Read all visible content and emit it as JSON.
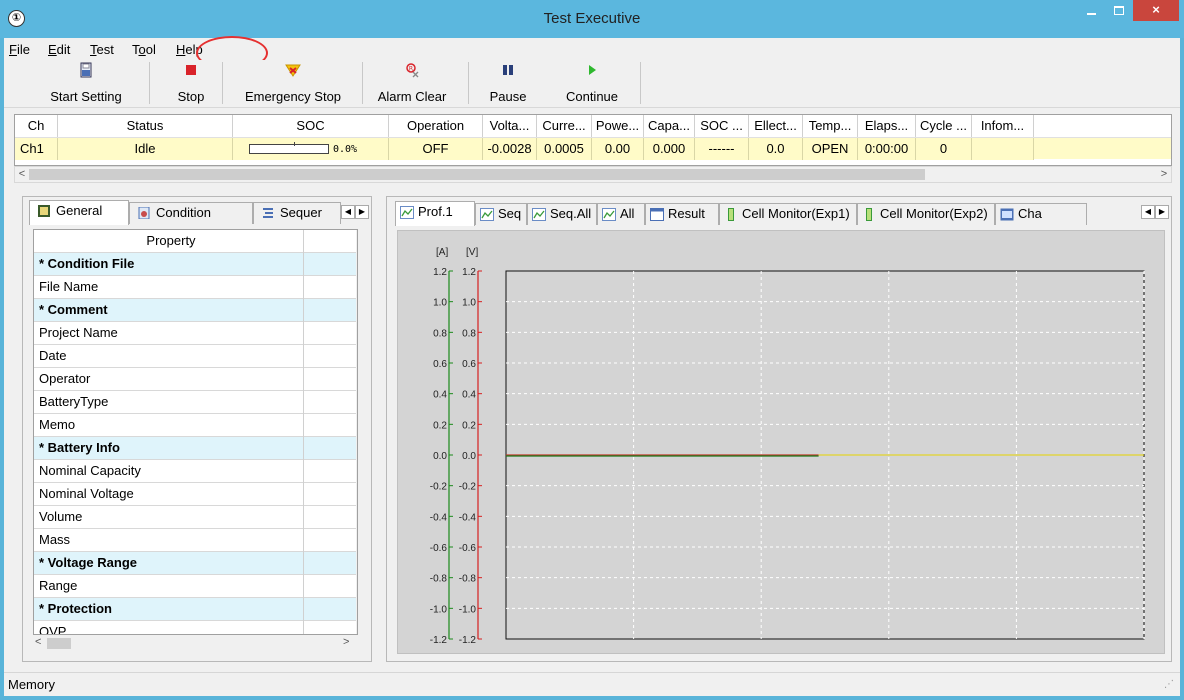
{
  "window": {
    "title": "Test Executive",
    "icon_glyph": "①",
    "minimize_icon": "minimize-icon",
    "maximize_icon": "maximize-icon",
    "close_glyph": "×"
  },
  "menu": {
    "items": [
      {
        "label": "File",
        "mnemonic": "F"
      },
      {
        "label": "Edit",
        "mnemonic": "E"
      },
      {
        "label": "Test",
        "mnemonic": "T"
      },
      {
        "label": "Tool",
        "mnemonic": "o"
      },
      {
        "label": "Help",
        "mnemonic": "H"
      }
    ]
  },
  "toolbar": {
    "start_setting": "Start Setting",
    "stop": "Stop",
    "emergency_stop": "Emergency Stop",
    "alarm_clear": "Alarm Clear",
    "pause": "Pause",
    "continue": "Continue"
  },
  "channel_table": {
    "headers": [
      "Ch",
      "Status",
      "SOC",
      "Operation",
      "Volta...",
      "Curre...",
      "Powe...",
      "Capa...",
      "SOC ...",
      "Ellect...",
      "Temp...",
      "Elaps...",
      "Cycle ...",
      "Infom..."
    ],
    "row": {
      "ch": "Ch1",
      "status": "Idle",
      "soc_text": "0.0%",
      "soc_fraction": 0.0,
      "operation": "OFF",
      "voltage": "-0.0028",
      "current": "0.0005",
      "power": "0.00",
      "capacity": "0.000",
      "soc2": "------",
      "ellect": "0.0",
      "temp": "OPEN",
      "elapsed": "0:00:00",
      "cycle": "0",
      "info": ""
    }
  },
  "left_panel": {
    "tabs": [
      "General",
      "Condition",
      "Sequer"
    ],
    "property_header": "Property",
    "rows": [
      {
        "label": "* Condition File",
        "section": true
      },
      {
        "label": "File Name",
        "section": false
      },
      {
        "label": "* Comment",
        "section": true
      },
      {
        "label": "Project Name",
        "section": false
      },
      {
        "label": "Date",
        "section": false
      },
      {
        "label": "Operator",
        "section": false
      },
      {
        "label": "BatteryType",
        "section": false
      },
      {
        "label": "Memo",
        "section": false
      },
      {
        "label": "* Battery Info",
        "section": true
      },
      {
        "label": "Nominal Capacity",
        "section": false
      },
      {
        "label": "Nominal Voltage",
        "section": false
      },
      {
        "label": "Volume",
        "section": false
      },
      {
        "label": "Mass",
        "section": false
      },
      {
        "label": "* Voltage Range",
        "section": true
      },
      {
        "label": "Range",
        "section": false
      },
      {
        "label": "* Protection",
        "section": true
      },
      {
        "label": "OVP",
        "section": false
      }
    ]
  },
  "right_panel": {
    "tabs": [
      "Prof.1",
      "Seq",
      "Seq.All",
      "All",
      "Result",
      "Cell Monitor(Exp1)",
      "Cell Monitor(Exp2)",
      "Cha"
    ]
  },
  "chart_data": {
    "type": "line",
    "title": "",
    "left_axis_label": "[A]",
    "right_axis_label": "[V]",
    "ylim": [
      -1.2,
      1.2
    ],
    "yticks": [
      "1.2",
      "1.0",
      "0.8",
      "0.6",
      "0.4",
      "0.2",
      "0.0",
      "-0.2",
      "-0.4",
      "-0.6",
      "-0.8",
      "-1.0",
      "-1.2"
    ],
    "grid": true,
    "series": [
      {
        "name": "",
        "color": "#c0392b",
        "x": [
          0,
          0.49
        ],
        "values": [
          0.0,
          0.0
        ]
      },
      {
        "name": "",
        "color": "#1a7a1a",
        "x": [
          0,
          0.49
        ],
        "values": [
          0.0,
          0.0
        ]
      },
      {
        "name": "",
        "color": "#e6d400",
        "x": [
          0.49,
          1.0
        ],
        "values": [
          0.0,
          0.0
        ]
      }
    ],
    "left_axis_color": "#1a8a1a",
    "right_axis_color": "#d62020"
  },
  "status_bar": {
    "text": "Memory"
  }
}
